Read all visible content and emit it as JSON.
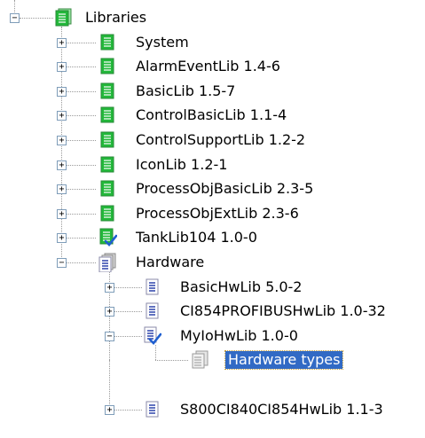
{
  "tree": {
    "root": {
      "label": "Libraries",
      "icon": "library-stack-icon",
      "expanded": true
    },
    "libraries": [
      {
        "label": "System",
        "icon": "library-icon"
      },
      {
        "label": "AlarmEventLib 1.4-6",
        "icon": "library-icon"
      },
      {
        "label": "BasicLib 1.5-7",
        "icon": "library-icon"
      },
      {
        "label": "ControlBasicLib 1.1-4",
        "icon": "library-icon"
      },
      {
        "label": "ControlSupportLib 1.2-2",
        "icon": "library-icon"
      },
      {
        "label": "IconLib 1.2-1",
        "icon": "library-icon"
      },
      {
        "label": "ProcessObjBasicLib 2.3-5",
        "icon": "library-icon"
      },
      {
        "label": "ProcessObjExtLib 2.3-6",
        "icon": "library-icon"
      },
      {
        "label": "TankLib104 1.0-0",
        "icon": "library-checked-icon"
      }
    ],
    "hardware": {
      "label": "Hardware",
      "icon": "hardware-folder-icon",
      "expanded": true,
      "items": [
        {
          "label": "BasicHwLib 5.0-2",
          "icon": "hardware-library-icon"
        },
        {
          "label": "CI854PROFIBUSHwLib 1.0-32",
          "icon": "hardware-library-icon"
        },
        {
          "label": "MyIoHwLib 1.0-0",
          "icon": "hardware-library-checked-icon",
          "expanded": true,
          "child": {
            "label": "Hardware types",
            "icon": "hardware-types-icon",
            "selected": true
          }
        },
        {
          "label": "S800CI840CI854HwLib 1.1-3",
          "icon": "hardware-library-icon"
        }
      ]
    },
    "colors": {
      "library_green": "#22b83a",
      "hardware_blue": "#3a4fb0",
      "selection": "#316ac5",
      "check_blue": "#1f5fd0"
    }
  }
}
